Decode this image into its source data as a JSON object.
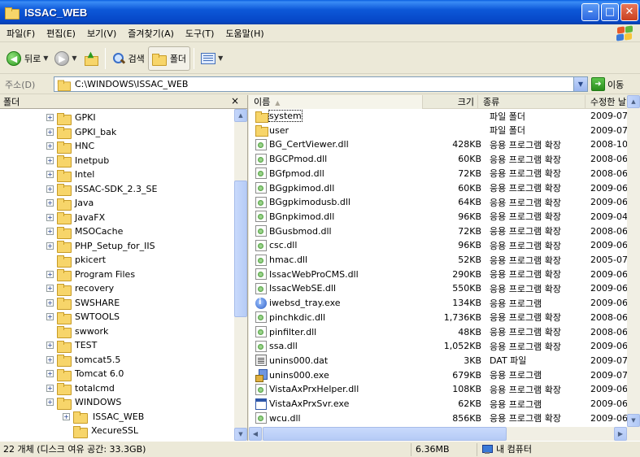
{
  "window": {
    "title": "ISSAC_WEB"
  },
  "menu": [
    "파일(F)",
    "편집(E)",
    "보기(V)",
    "즐겨찾기(A)",
    "도구(T)",
    "도움말(H)"
  ],
  "toolbar": {
    "back": "뒤로",
    "search": "검색",
    "folders": "폴더"
  },
  "address": {
    "label": "주소(D)",
    "path": "C:\\WINDOWS\\ISSAC_WEB",
    "go": "이동"
  },
  "folder_pane": {
    "title": "폴더",
    "close": "×",
    "tree": [
      {
        "name": "GPKI",
        "expand": true
      },
      {
        "name": "GPKI_bak",
        "expand": true
      },
      {
        "name": "HNC",
        "expand": true
      },
      {
        "name": "Inetpub",
        "expand": true
      },
      {
        "name": "Intel",
        "expand": true
      },
      {
        "name": "ISSAC-SDK_2.3_SE",
        "expand": true
      },
      {
        "name": "Java",
        "expand": true
      },
      {
        "name": "JavaFX",
        "expand": true
      },
      {
        "name": "MSOCache",
        "expand": true
      },
      {
        "name": "PHP_Setup_for_IIS",
        "expand": true
      },
      {
        "name": "pkicert",
        "expand": false
      },
      {
        "name": "Program Files",
        "expand": true
      },
      {
        "name": "recovery",
        "expand": true
      },
      {
        "name": "SWSHARE",
        "expand": true
      },
      {
        "name": "SWTOOLS",
        "expand": true
      },
      {
        "name": "swwork",
        "expand": false
      },
      {
        "name": "TEST",
        "expand": true
      },
      {
        "name": "tomcat5.5",
        "expand": true
      },
      {
        "name": "Tomcat 6.0",
        "expand": true
      },
      {
        "name": "totalcmd",
        "expand": true
      },
      {
        "name": "WINDOWS",
        "expand": true
      },
      {
        "name": "ISSAC_WEB",
        "expand": true,
        "child": true,
        "selected": true
      },
      {
        "name": "XecureSSL",
        "expand": false,
        "child": true
      }
    ]
  },
  "columns": {
    "name": "이름",
    "size": "크기",
    "type": "종류",
    "modified": "수정한 날"
  },
  "files": [
    {
      "icon": "folder",
      "name": "system",
      "size": "",
      "type": "파일 폴더",
      "modified": "2009-07-:"
    },
    {
      "icon": "folder",
      "name": "user",
      "size": "",
      "type": "파일 폴더",
      "modified": "2009-07-:"
    },
    {
      "icon": "dll",
      "name": "BG_CertViewer.dll",
      "size": "428KB",
      "type": "응용 프로그램 확장",
      "modified": "2008-10-"
    },
    {
      "icon": "dll",
      "name": "BGCPmod.dll",
      "size": "60KB",
      "type": "응용 프로그램 확장",
      "modified": "2008-06-:"
    },
    {
      "icon": "dll",
      "name": "BGfpmod.dll",
      "size": "72KB",
      "type": "응용 프로그램 확장",
      "modified": "2008-06-:"
    },
    {
      "icon": "dll",
      "name": "BGgpkimod.dll",
      "size": "60KB",
      "type": "응용 프로그램 확장",
      "modified": "2009-06-:"
    },
    {
      "icon": "dll",
      "name": "BGgpkimodusb.dll",
      "size": "64KB",
      "type": "응용 프로그램 확장",
      "modified": "2009-06-:"
    },
    {
      "icon": "dll",
      "name": "BGnpkimod.dll",
      "size": "96KB",
      "type": "응용 프로그램 확장",
      "modified": "2009-04-:"
    },
    {
      "icon": "dll",
      "name": "BGusbmod.dll",
      "size": "72KB",
      "type": "응용 프로그램 확장",
      "modified": "2008-06-:"
    },
    {
      "icon": "dll",
      "name": "csc.dll",
      "size": "96KB",
      "type": "응용 프로그램 확장",
      "modified": "2009-06-"
    },
    {
      "icon": "dll",
      "name": "hmac.dll",
      "size": "52KB",
      "type": "응용 프로그램 확장",
      "modified": "2005-07-:"
    },
    {
      "icon": "dll",
      "name": "IssacWebProCMS.dll",
      "size": "290KB",
      "type": "응용 프로그램 확장",
      "modified": "2009-06-:"
    },
    {
      "icon": "dll",
      "name": "IssacWebSE.dll",
      "size": "550KB",
      "type": "응용 프로그램 확장",
      "modified": "2009-06-:"
    },
    {
      "icon": "exe-info",
      "name": "iwebsd_tray.exe",
      "size": "134KB",
      "type": "응용 프로그램",
      "modified": "2009-06-:"
    },
    {
      "icon": "dll",
      "name": "pinchkdic.dll",
      "size": "1,736KB",
      "type": "응용 프로그램 확장",
      "modified": "2008-06-:"
    },
    {
      "icon": "dll",
      "name": "pinfilter.dll",
      "size": "48KB",
      "type": "응용 프로그램 확장",
      "modified": "2008-06-:"
    },
    {
      "icon": "dll",
      "name": "ssa.dll",
      "size": "1,052KB",
      "type": "응용 프로그램 확장",
      "modified": "2009-06-"
    },
    {
      "icon": "dat",
      "name": "unins000.dat",
      "size": "3KB",
      "type": "DAT 파일",
      "modified": "2009-07-:"
    },
    {
      "icon": "setup",
      "name": "unins000.exe",
      "size": "679KB",
      "type": "응용 프로그램",
      "modified": "2009-07-:"
    },
    {
      "icon": "dll",
      "name": "VistaAxPrxHelper.dll",
      "size": "108KB",
      "type": "응용 프로그램 확장",
      "modified": "2009-06-:"
    },
    {
      "icon": "window",
      "name": "VistaAxPrxSvr.exe",
      "size": "62KB",
      "type": "응용 프로그램",
      "modified": "2009-06-:"
    },
    {
      "icon": "dll",
      "name": "wcu.dll",
      "size": "856KB",
      "type": "응용 프로그램 확장",
      "modified": "2009-06-:"
    }
  ],
  "status": {
    "objects": "22 개체 (디스크 여유 공간: 33.3GB)",
    "size": "6.36MB",
    "location": "내 컴퓨터"
  }
}
